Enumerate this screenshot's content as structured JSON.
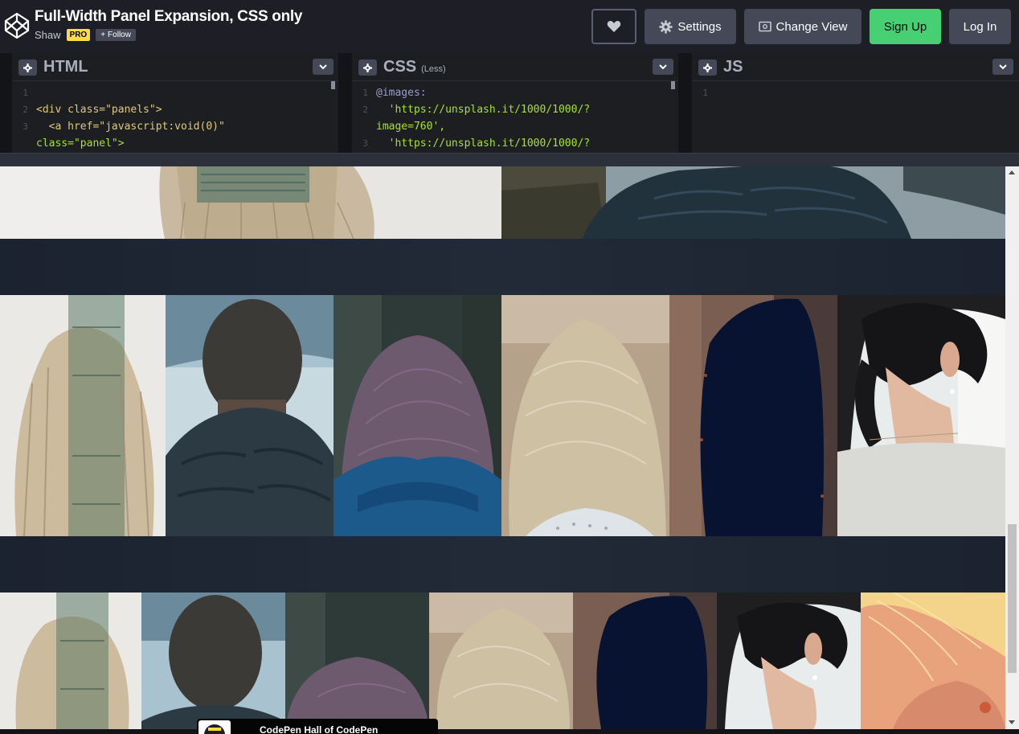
{
  "header": {
    "title": "Full-Width Panel Expansion, CSS only",
    "author": "Shaw",
    "pro_badge": "PRO",
    "follow_label": "Follow",
    "settings_label": "Settings",
    "change_view_label": "Change View",
    "signup_label": "Sign Up",
    "login_label": "Log In"
  },
  "editors": {
    "html": {
      "title": "HTML",
      "line_numbers": [
        "1",
        "2",
        "3",
        ""
      ],
      "lines": [
        "",
        "<div class=\"panels\">",
        "  <a href=\"javascript:void(0)\"",
        "class=\"panel\">"
      ]
    },
    "css": {
      "title": "CSS",
      "subtitle": "(Less)",
      "line_numbers": [
        "1",
        "2",
        "",
        "3"
      ],
      "lines": [
        "@images:",
        "  'https://unsplash.it/1000/1000/?",
        "image=760',",
        "  'https://unsplash.it/1000/1000/?"
      ]
    },
    "js": {
      "title": "JS",
      "line_numbers": [
        "1"
      ]
    }
  },
  "toast": {
    "text": "CodePen Hall of CodePen"
  },
  "colors": {
    "accent_green": "#47cf73",
    "pro_yellow": "#ffdd40",
    "button_gray": "#444857",
    "header_bg": "#1e1f26",
    "preview_bg": "#1d2330"
  },
  "icons": [
    "codepen-logo-icon",
    "heart-icon",
    "gear-icon",
    "change-view-icon",
    "plus-icon",
    "chevron-down-icon"
  ]
}
